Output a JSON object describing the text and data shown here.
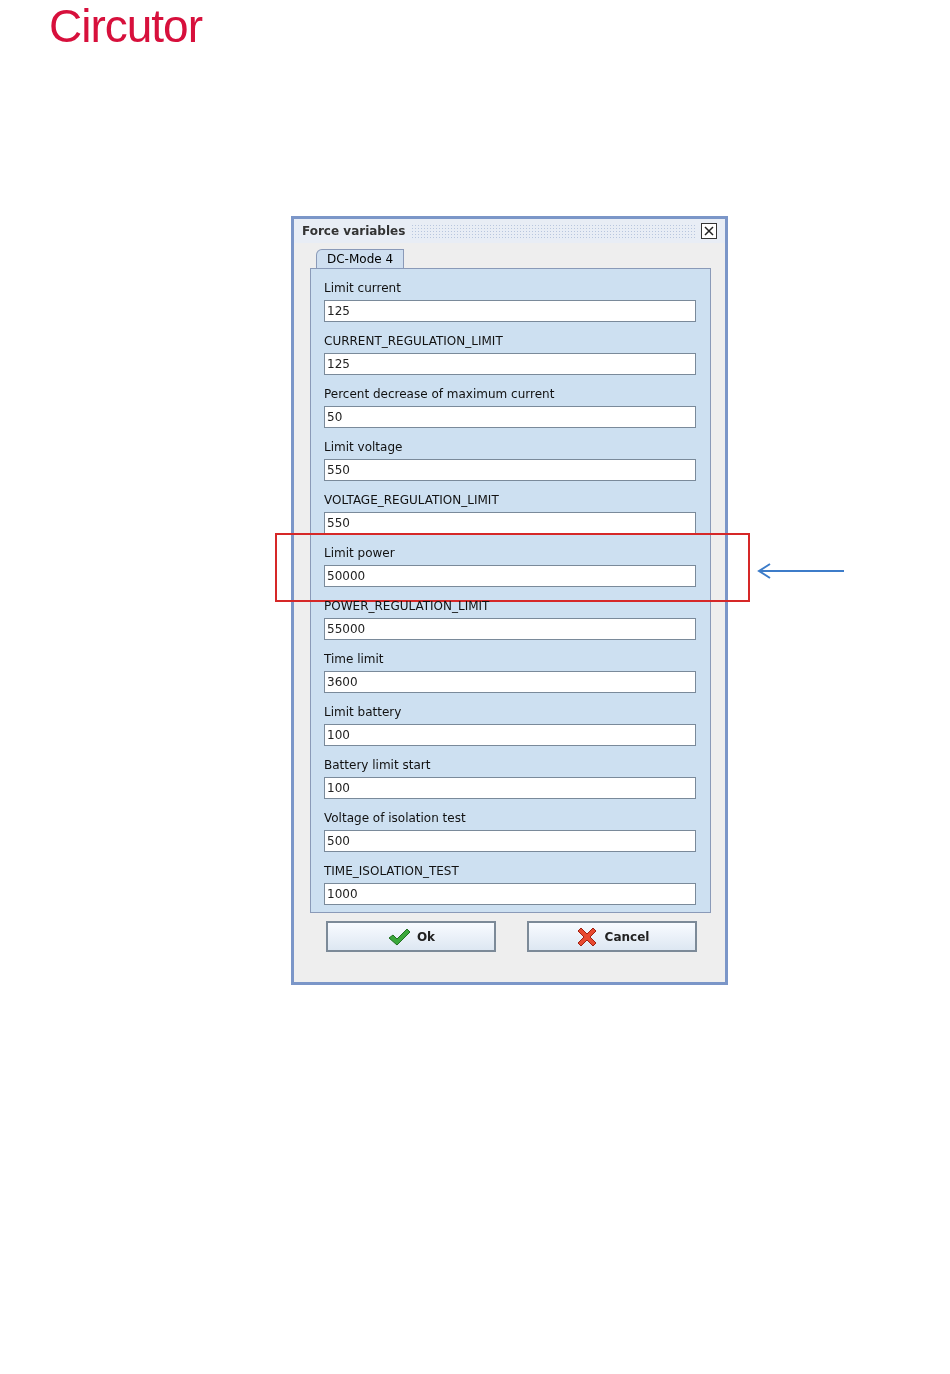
{
  "logo": {
    "text": "Circutor"
  },
  "window": {
    "title": "Force variables"
  },
  "tabs": [
    {
      "label": "DC-Mode 4",
      "selected": true
    }
  ],
  "fields": [
    {
      "label": "Limit current",
      "value": "125",
      "highlighted": false
    },
    {
      "label": "CURRENT_REGULATION_LIMIT",
      "value": "125",
      "highlighted": false
    },
    {
      "label": "Percent decrease of maximum current",
      "value": "50",
      "highlighted": false
    },
    {
      "label": "Limit voltage",
      "value": "550",
      "highlighted": false
    },
    {
      "label": "VOLTAGE_REGULATION_LIMIT",
      "value": "550",
      "highlighted": false
    },
    {
      "label": "Limit power",
      "value": "50000",
      "highlighted": true
    },
    {
      "label": "POWER_REGULATION_LIMIT",
      "value": "55000",
      "highlighted": false
    },
    {
      "label": "Time limit",
      "value": "3600",
      "highlighted": false
    },
    {
      "label": "Limit battery",
      "value": "100",
      "highlighted": false
    },
    {
      "label": "Battery limit start",
      "value": "100",
      "highlighted": false
    },
    {
      "label": "Voltage of isolation test",
      "value": "500",
      "highlighted": false
    },
    {
      "label": "TIME_ISOLATION_TEST",
      "value": "1000",
      "highlighted": false
    }
  ],
  "buttons": [
    {
      "label": "Ok",
      "kind": "ok"
    },
    {
      "label": "Cancel",
      "kind": "cancel"
    }
  ]
}
